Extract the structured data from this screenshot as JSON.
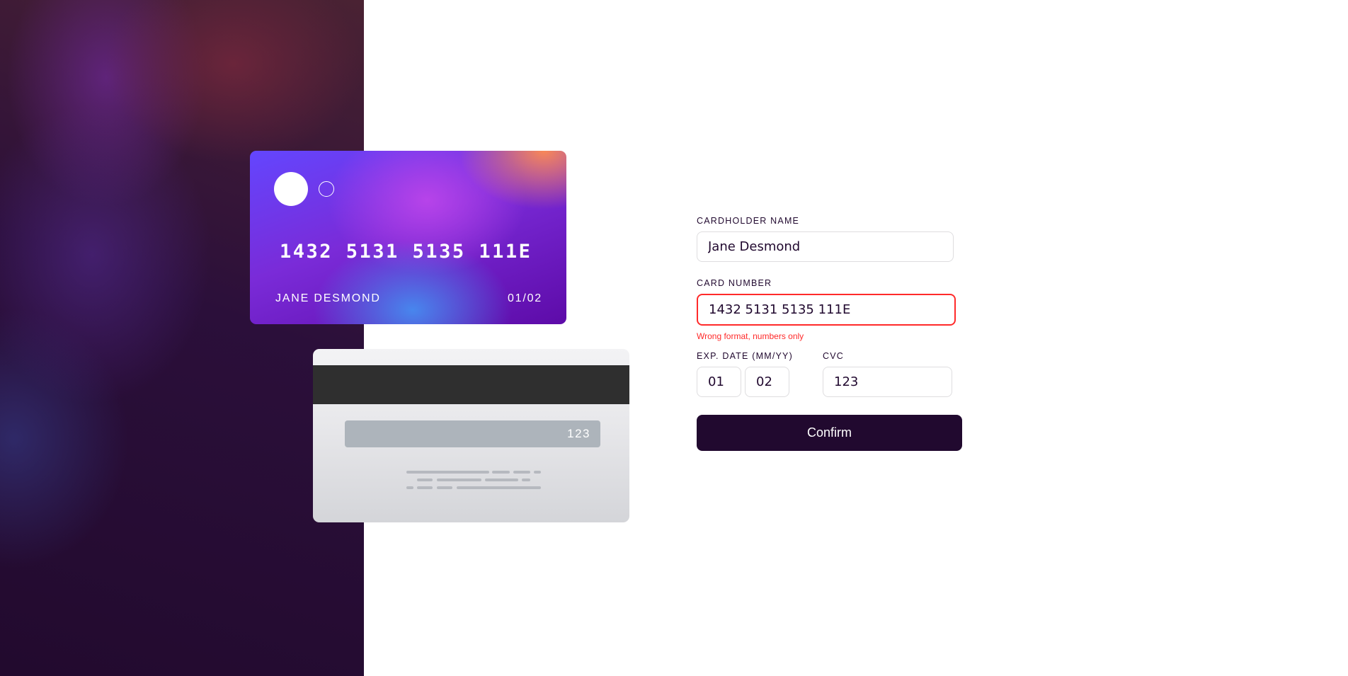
{
  "card_front": {
    "number": "1432 5131 5135 111E",
    "name": "JANE DESMOND",
    "expiry": "01/02"
  },
  "card_back": {
    "cvc": "123"
  },
  "form": {
    "cardholder_label": "CARDHOLDER NAME",
    "cardholder_value": "Jane Desmond",
    "card_number_label": "CARD NUMBER",
    "card_number_value": "1432 5131 5135 111E",
    "card_number_error": "Wrong format, numbers only",
    "exp_label": "EXP. DATE (MM/YY)",
    "exp_month": "01",
    "exp_year": "02",
    "cvc_label": "CVC",
    "cvc_value": "123",
    "confirm_label": "Confirm"
  },
  "colors": {
    "dark_violet": "#21092f",
    "error_red": "#ff2a2a",
    "border_gray": "#dedddf"
  }
}
